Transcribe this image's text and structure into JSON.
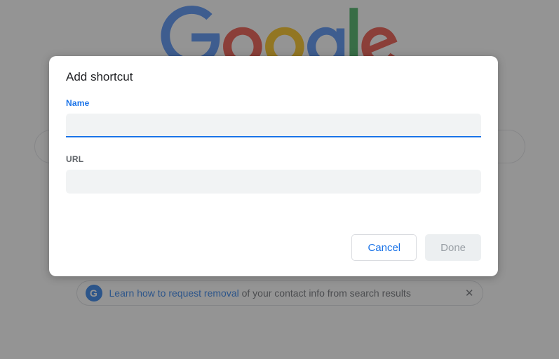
{
  "logo": {
    "name": "Google"
  },
  "banner": {
    "link_text": "Learn how to request removal",
    "rest_text": " of your contact info from search results"
  },
  "dialog": {
    "title": "Add shortcut",
    "name_label": "Name",
    "name_value": "",
    "url_label": "URL",
    "url_value": "",
    "cancel_label": "Cancel",
    "done_label": "Done"
  }
}
